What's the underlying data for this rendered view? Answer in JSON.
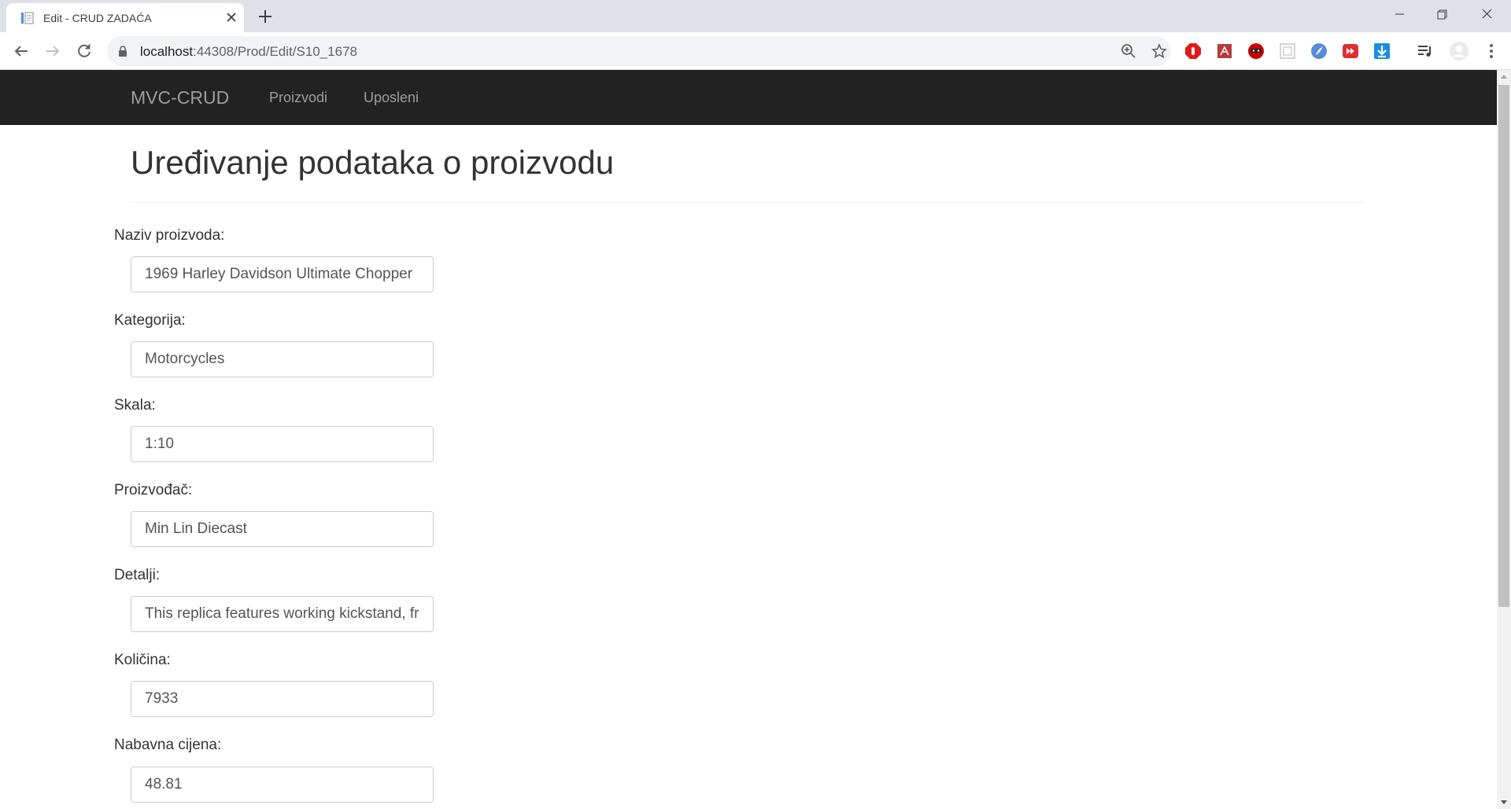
{
  "browser": {
    "tab_title": "Edit - CRUD ZADAĆA",
    "url_host": "localhost",
    "url_path": ":44308/Prod/Edit/S10_1678"
  },
  "nav": {
    "brand": "MVC-CRUD",
    "links": [
      "Proizvodi",
      "Uposleni"
    ]
  },
  "page": {
    "title": "Uređivanje podataka o proizvodu"
  },
  "form": {
    "fields": [
      {
        "label": "Naziv proizvoda:",
        "value": "1969 Harley Davidson Ultimate Chopper"
      },
      {
        "label": "Kategorija:",
        "value": "Motorcycles"
      },
      {
        "label": "Skala:",
        "value": "1:10"
      },
      {
        "label": "Proizvođač:",
        "value": "Min Lin Diecast"
      },
      {
        "label": "Detalji:",
        "value": "This replica features working kickstand, front suspension, gear-shift lever, footbrake lever, drive chain, wheels and steering."
      },
      {
        "label": "Količina:",
        "value": "7933"
      },
      {
        "label": "Nabavna cijena:",
        "value": "48.81"
      }
    ]
  },
  "icons": {
    "tab_favicon": "document-icon",
    "extensions": [
      "adblock-icon",
      "pdf-icon",
      "ninja-icon",
      "frame-icon",
      "paint-icon",
      "video-icon",
      "download-icon",
      "playlist-icon",
      "profile-icon"
    ]
  }
}
